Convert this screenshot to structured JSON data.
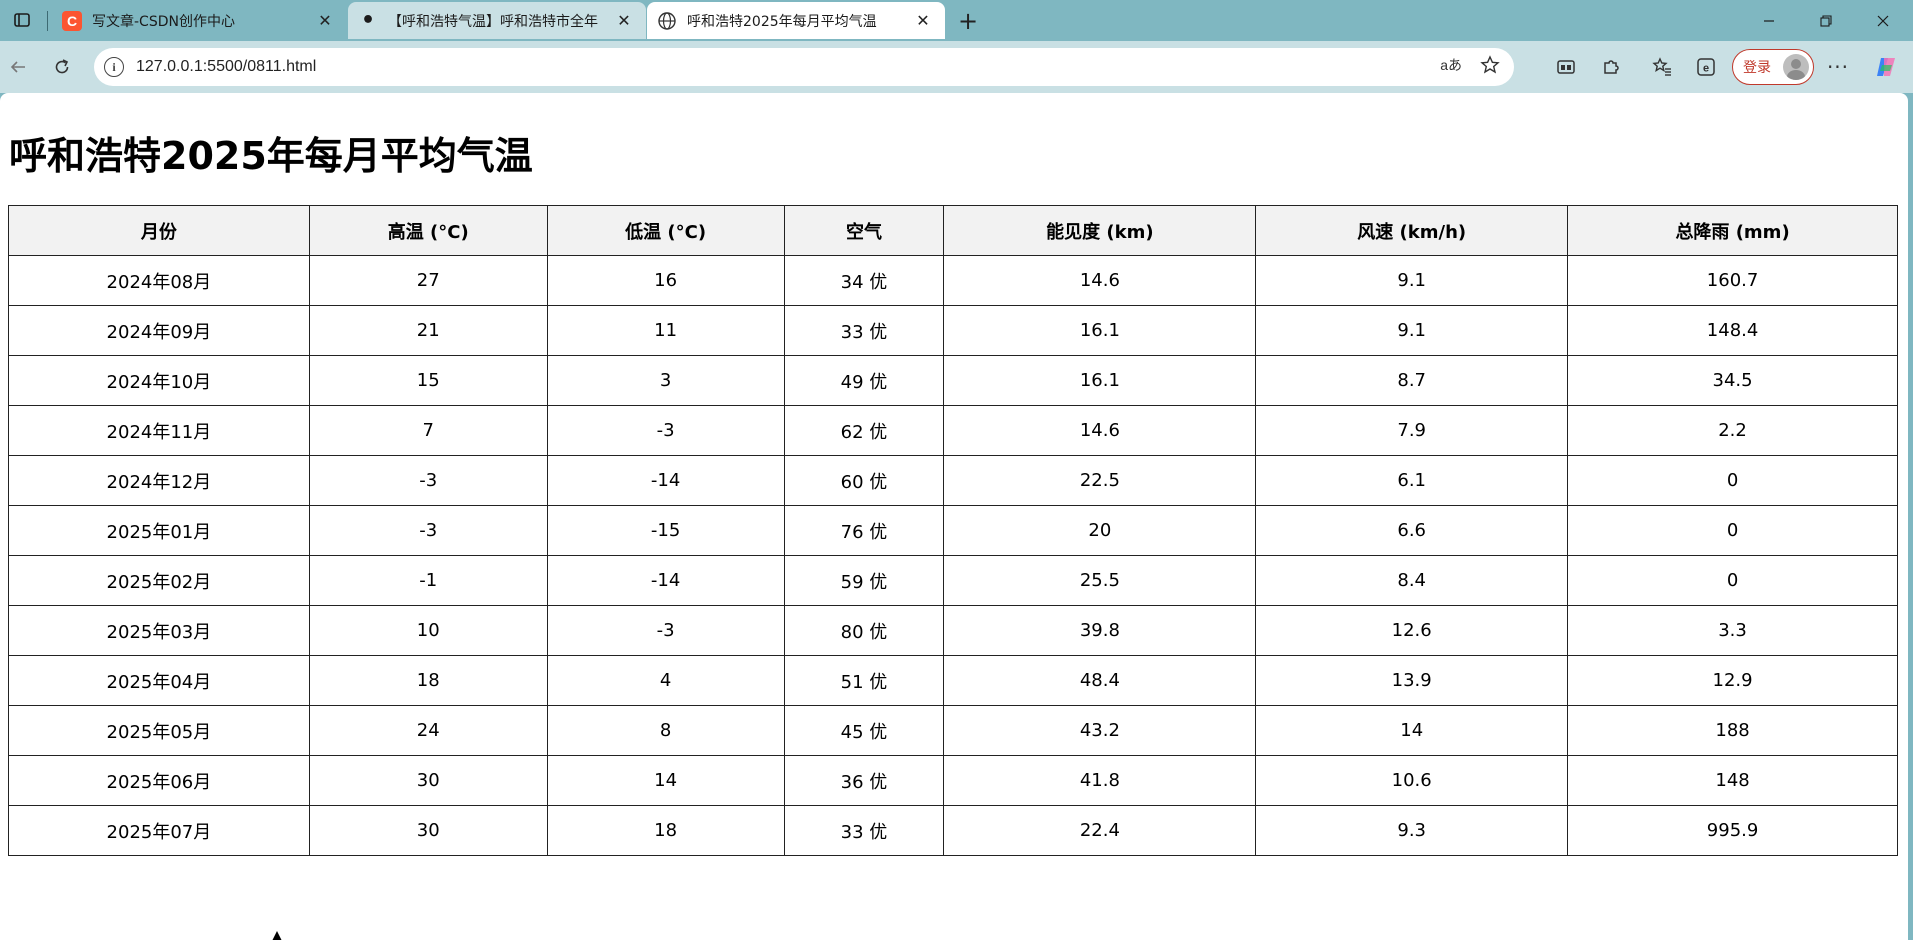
{
  "browser": {
    "tabs": [
      {
        "title": "写文章-CSDN创作中心",
        "favicon": "csdn-icon",
        "favicon_text": "C"
      },
      {
        "title": "【呼和浩特气温】呼和浩特市全年",
        "favicon": "dot-icon",
        "favicon_text": "•"
      },
      {
        "title": "呼和浩特2025年每月平均气温",
        "favicon": "globe-icon"
      }
    ],
    "url": "127.0.0.1:5500/0811.html",
    "read_aloud_label": "aあ",
    "login_label": "登录",
    "colors": {
      "tabstrip": "#7fb7c1",
      "toolbar": "#c9e0e4",
      "login_accent": "#c0392b",
      "csdn": "#fc5531"
    }
  },
  "page": {
    "title": "呼和浩特2025年每月平均气温",
    "table": {
      "headers": [
        "月份",
        "高温 (°C)",
        "低温 (°C)",
        "空气",
        "能见度 (km)",
        "风速 (km/h)",
        "总降雨 (mm)"
      ],
      "rows": [
        [
          "2024年08月",
          "27",
          "16",
          "34 优",
          "14.6",
          "9.1",
          "160.7"
        ],
        [
          "2024年09月",
          "21",
          "11",
          "33 优",
          "16.1",
          "9.1",
          "148.4"
        ],
        [
          "2024年10月",
          "15",
          "3",
          "49 优",
          "16.1",
          "8.7",
          "34.5"
        ],
        [
          "2024年11月",
          "7",
          "-3",
          "62 优",
          "14.6",
          "7.9",
          "2.2"
        ],
        [
          "2024年12月",
          "-3",
          "-14",
          "60 优",
          "22.5",
          "6.1",
          "0"
        ],
        [
          "2025年01月",
          "-3",
          "-15",
          "76 优",
          "20",
          "6.6",
          "0"
        ],
        [
          "2025年02月",
          "-1",
          "-14",
          "59 优",
          "25.5",
          "8.4",
          "0"
        ],
        [
          "2025年03月",
          "10",
          "-3",
          "80 优",
          "39.8",
          "12.6",
          "3.3"
        ],
        [
          "2025年04月",
          "18",
          "4",
          "51 优",
          "48.4",
          "13.9",
          "12.9"
        ],
        [
          "2025年05月",
          "24",
          "8",
          "45 优",
          "43.2",
          "14",
          "188"
        ],
        [
          "2025年06月",
          "30",
          "14",
          "36 优",
          "41.8",
          "10.6",
          "148"
        ],
        [
          "2025年07月",
          "30",
          "18",
          "33 优",
          "22.4",
          "9.3",
          "995.9"
        ]
      ]
    }
  }
}
